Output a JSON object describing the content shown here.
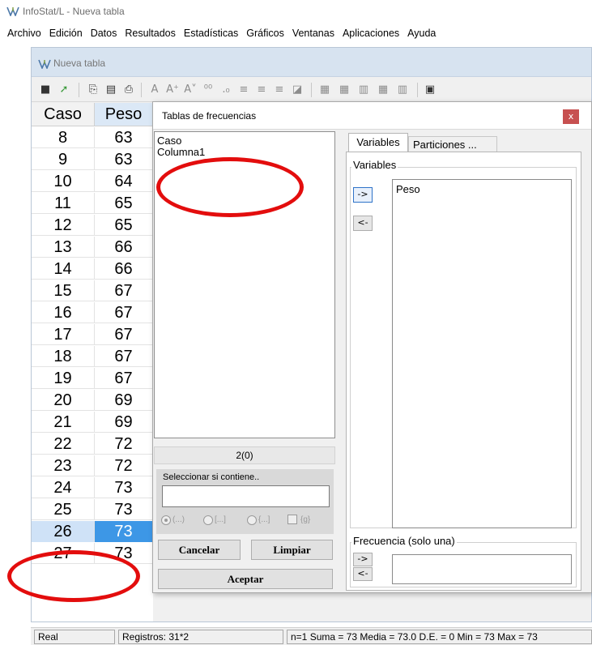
{
  "app": {
    "title": "InfoStat/L - Nueva tabla"
  },
  "menu": [
    "Archivo",
    "Edición",
    "Datos",
    "Resultados",
    "Estadísticas",
    "Gráficos",
    "Ventanas",
    "Aplicaciones",
    "Ayuda"
  ],
  "child_window": {
    "title": "Nueva tabla"
  },
  "toolbar": {
    "icons": [
      "save-icon",
      "open-icon",
      "copy-icon",
      "paste-icon",
      "print-icon",
      "font-icon",
      "font-grow-icon",
      "font-shrink-icon",
      "decimals-add-icon",
      "decimals-remove-icon",
      "align-left-icon",
      "align-center-icon",
      "align-right-icon",
      "eraser-icon",
      "insert-row-icon",
      "delete-row-icon",
      "insert-column-icon",
      "table-icon",
      "delete-column-icon",
      "calculator-icon"
    ]
  },
  "grid": {
    "headers": [
      "Caso",
      "Peso"
    ],
    "rows": [
      [
        "8",
        "63"
      ],
      [
        "9",
        "63"
      ],
      [
        "10",
        "64"
      ],
      [
        "11",
        "65"
      ],
      [
        "12",
        "65"
      ],
      [
        "13",
        "66"
      ],
      [
        "14",
        "66"
      ],
      [
        "15",
        "67"
      ],
      [
        "16",
        "67"
      ],
      [
        "17",
        "67"
      ],
      [
        "18",
        "67"
      ],
      [
        "19",
        "67"
      ],
      [
        "20",
        "69"
      ],
      [
        "21",
        "69"
      ],
      [
        "22",
        "72"
      ],
      [
        "23",
        "72"
      ],
      [
        "24",
        "73"
      ],
      [
        "25",
        "73"
      ],
      [
        "26",
        "73"
      ],
      [
        "27",
        "73"
      ]
    ],
    "selected_row": "26"
  },
  "dialog": {
    "title": "Tablas de frecuencias",
    "close_label": "x",
    "source_items": [
      "Caso",
      "Columna1"
    ],
    "count_label": "2(0)",
    "filter": {
      "label": "Seleccionar si contiene..",
      "value": "",
      "options": [
        "(...)",
        "[...]",
        "{...]",
        "{g}"
      ],
      "selected_option": "(...)"
    },
    "buttons": {
      "cancel": "Cancelar",
      "clear": "Limpiar",
      "accept": "Aceptar"
    },
    "tabs": [
      "Variables",
      "Particiones ..."
    ],
    "active_tab": "Variables",
    "variables_group": {
      "label": "Variables",
      "items": [
        "Peso"
      ],
      "add": "->",
      "remove": "<-"
    },
    "frequency_group": {
      "label": "Frecuencia (solo una)",
      "items": [],
      "add": "->",
      "remove": "<-"
    }
  },
  "status_bar": {
    "type": "Real",
    "records": "Registros: 31*2",
    "summary": "n=1  Suma = 73  Media = 73.0  D.E. = 0  Min = 73  Max = 73"
  },
  "annotations": {
    "color": "#e30d0d"
  }
}
